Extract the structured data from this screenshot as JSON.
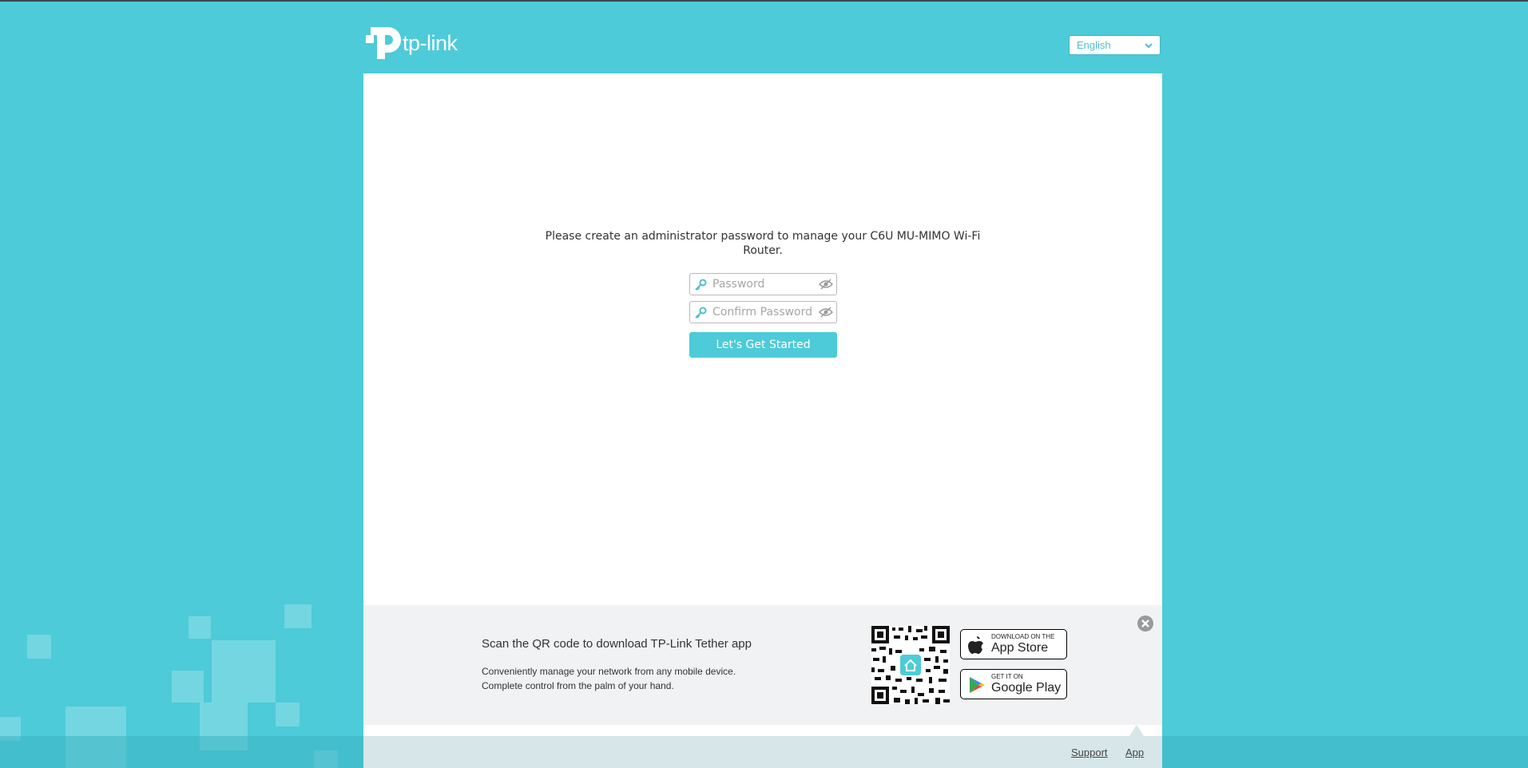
{
  "header": {
    "logo_text": "tp-link",
    "language": {
      "selected": "English"
    }
  },
  "setup": {
    "message": "Please create an administrator password to manage your C6U MU-MIMO Wi-Fi Router.",
    "password": {
      "value": "",
      "placeholder": "Password"
    },
    "confirm_password": {
      "value": "",
      "placeholder": "Confirm Password"
    },
    "start_button": "Let's Get Started"
  },
  "app_banner": {
    "title": "Scan the QR code to download TP-Link Tether app",
    "desc_line1": "Conveniently manage your network from any mobile device.",
    "desc_line2": "Complete control from the palm of your hand.",
    "app_store": {
      "small": "DOWNLOAD ON THE",
      "big": "App Store"
    },
    "google_play": {
      "small": "GET IT ON",
      "big": "Google Play"
    }
  },
  "footer": {
    "support": "Support",
    "app": "App"
  },
  "colors": {
    "brand": "#4dcbd8",
    "panel": "#ffffff",
    "banner": "#f1f2f3"
  }
}
